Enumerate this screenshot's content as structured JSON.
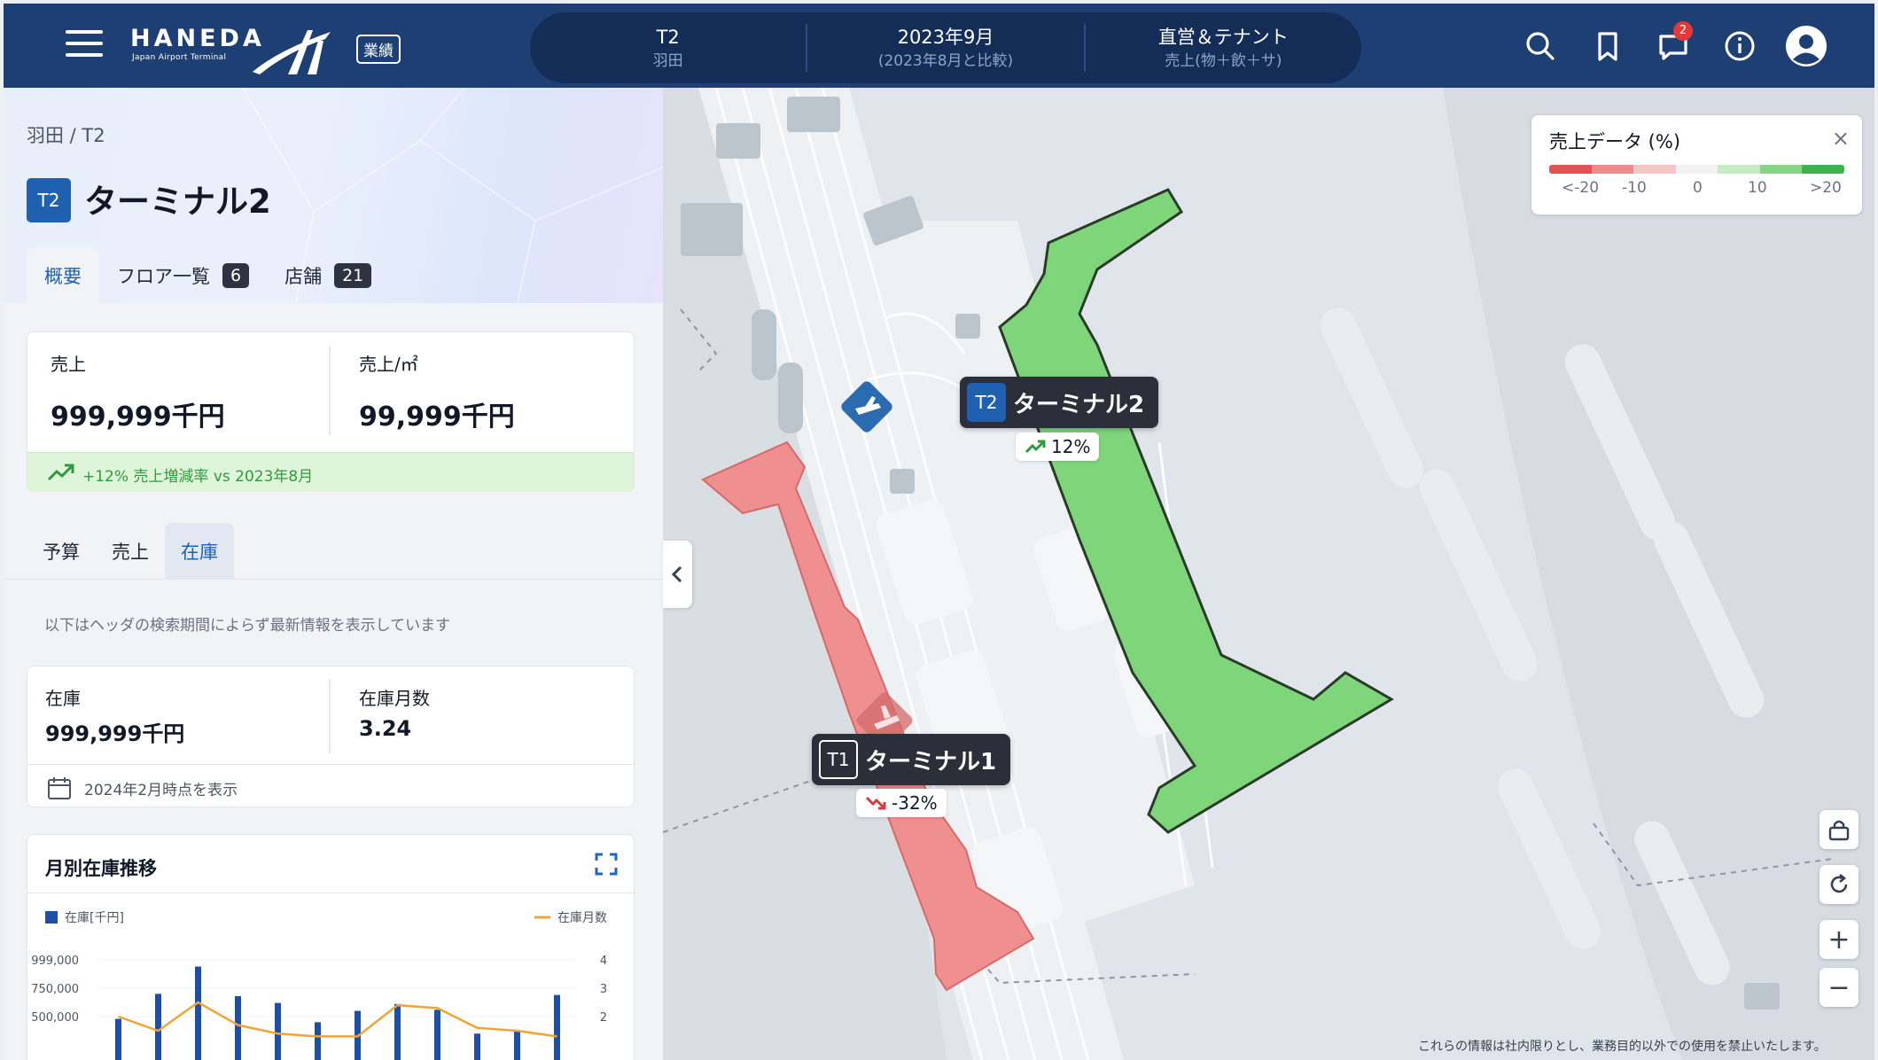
{
  "header": {
    "brand": "HANEDA",
    "brand_sub": "Japan Airport Terminal",
    "mode_badge": "業績",
    "context": [
      {
        "title": "T2",
        "sub": "羽田"
      },
      {
        "title": "2023年9月",
        "sub": "(2023年8月と比較)"
      },
      {
        "title": "直営＆テナント",
        "sub": "売上(物＋飲＋サ)"
      }
    ],
    "notification_count": "2",
    "icons": [
      "search-icon",
      "bookmark-icon",
      "chat-icon",
      "info-icon",
      "user-icon"
    ]
  },
  "panel": {
    "breadcrumb": "羽田 / T2",
    "terminal_code": "T2",
    "title": "ターミナル2",
    "tabs": [
      {
        "label": "概要"
      },
      {
        "label": "フロア一覧",
        "count": "6"
      },
      {
        "label": "店舗",
        "count": "21"
      }
    ],
    "sales": {
      "label": "売上",
      "value": "999,999千円",
      "per_area_label": "売上/㎡",
      "per_area_value": "99,999千円",
      "growth": "+12% 売上増減率 vs 2023年8月"
    },
    "sub_tabs": [
      "予算",
      "売上",
      "在庫"
    ],
    "note": "以下はヘッダの検索期間によらず最新情報を表示しています",
    "stock": {
      "label": "在庫",
      "value": "999,999千円",
      "months_label": "在庫月数",
      "months_value": "3.24",
      "as_of": "2024年2月時点を表示"
    },
    "chart_title": "月別在庫推移"
  },
  "chart_data": {
    "type": "bar",
    "legend": [
      {
        "name": "在庫[千円]",
        "color": "#1d4fa8"
      },
      {
        "name": "在庫月数",
        "color": "#f0a436"
      }
    ],
    "left_ticks": [
      "999,000",
      "750,000",
      "500,000"
    ],
    "right_ticks": [
      "4",
      "3",
      "2"
    ],
    "series": [
      {
        "name": "在庫[千円]",
        "values": [
          480000,
          700000,
          940000,
          680000,
          620000,
          450000,
          550000,
          610000,
          560000,
          350000,
          380000,
          690000
        ]
      },
      {
        "name": "在庫月数",
        "values": [
          2.0,
          1.5,
          2.5,
          1.7,
          1.4,
          1.3,
          1.3,
          2.4,
          2.3,
          1.6,
          1.5,
          1.3
        ]
      }
    ]
  },
  "map": {
    "legend_title": "売上データ (%)",
    "legend_close": "×",
    "legend_colors": [
      "#e35353",
      "#ee8b8b",
      "#f6c5c5",
      "#f2f2f2",
      "#c6ecc2",
      "#86d681",
      "#3fb34a"
    ],
    "legend_ticks": [
      "<-20",
      "-10",
      "0",
      "10",
      ">20"
    ],
    "terminals": [
      {
        "code": "T2",
        "name": "ターミナル2",
        "change": "12%",
        "trend": "up"
      },
      {
        "code": "T1",
        "name": "ターミナル1",
        "change": "-32%",
        "trend": "down"
      }
    ],
    "controls": [
      "lock-icon",
      "refresh-icon",
      "zoom-in",
      "zoom-out"
    ],
    "zoom_in_label": "+",
    "zoom_out_label": "−",
    "disclaimer": "これらの情報は社内限りとし、業務目的以外での使用を禁止いたします。"
  }
}
